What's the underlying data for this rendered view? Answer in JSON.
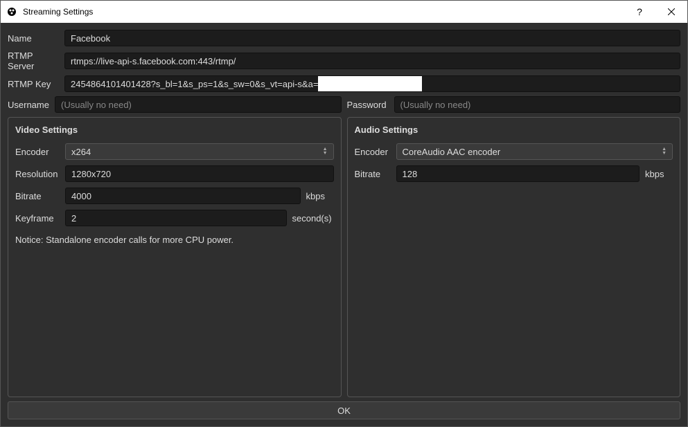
{
  "window": {
    "title": "Streaming Settings"
  },
  "form": {
    "name_label": "Name",
    "name_value": "Facebook",
    "rtmp_server_label": "RTMP Server",
    "rtmp_server_value": "rtmps://live-api-s.facebook.com:443/rtmp/",
    "rtmp_key_label": "RTMP Key",
    "rtmp_key_value": "2454864101401428?s_bl=1&s_ps=1&s_sw=0&s_vt=api-s&a=",
    "username_label": "Username",
    "username_placeholder": "(Usually no need)",
    "password_label": "Password",
    "password_placeholder": "(Usually no need)"
  },
  "video": {
    "title": "Video Settings",
    "encoder_label": "Encoder",
    "encoder_value": "x264",
    "resolution_label": "Resolution",
    "resolution_value": "1280x720",
    "bitrate_label": "Bitrate",
    "bitrate_value": "4000",
    "bitrate_unit": "kbps",
    "keyframe_label": "Keyframe",
    "keyframe_value": "2",
    "keyframe_unit": "second(s)",
    "notice": "Notice: Standalone encoder calls for more CPU power."
  },
  "audio": {
    "title": "Audio Settings",
    "encoder_label": "Encoder",
    "encoder_value": "CoreAudio AAC encoder",
    "bitrate_label": "Bitrate",
    "bitrate_value": "128",
    "bitrate_unit": "kbps"
  },
  "footer": {
    "ok_label": "OK"
  }
}
